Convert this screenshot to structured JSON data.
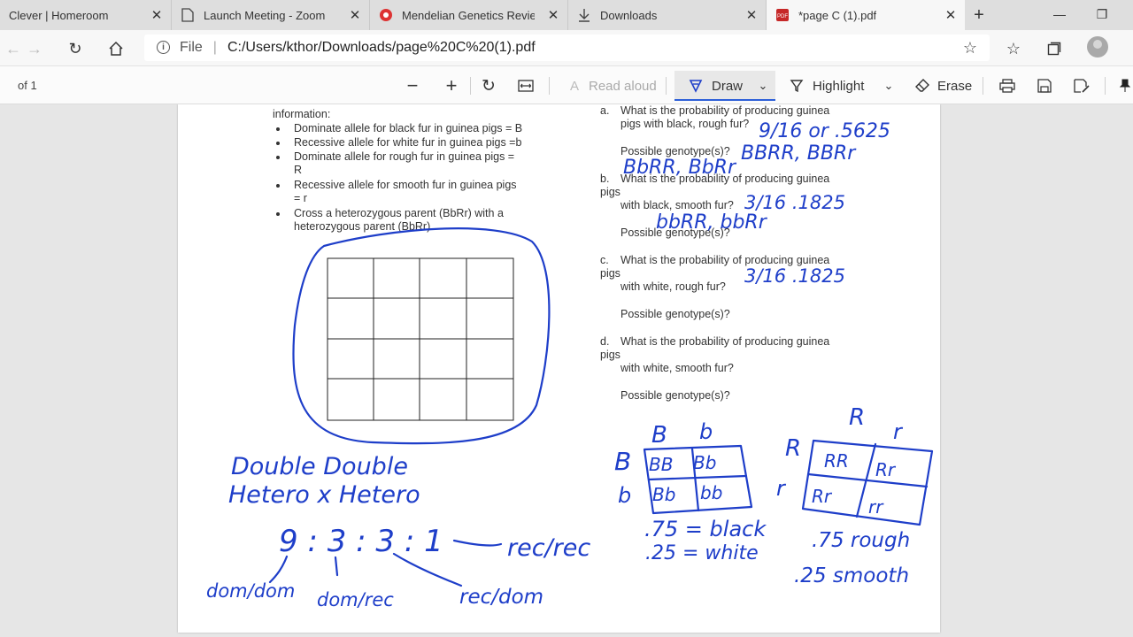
{
  "tabs": [
    {
      "title": "Clever | Homeroom",
      "icon": "none-icon"
    },
    {
      "title": "Launch Meeting - Zoom",
      "icon": "page-icon"
    },
    {
      "title": "Mendelian Genetics Review",
      "icon": "lab-icon"
    },
    {
      "title": "Downloads",
      "icon": "download-icon"
    },
    {
      "title": "*page C (1).pdf",
      "icon": "pdf-icon"
    }
  ],
  "address": {
    "scheme_label": "File",
    "url": "C:/Users/kthor/Downloads/page%20C%20(1).pdf"
  },
  "pdf_toolbar": {
    "page_count": "of 1",
    "read_aloud": "Read aloud",
    "draw": "Draw",
    "highlight": "Highlight",
    "erase": "Erase"
  },
  "document": {
    "intro": "information:",
    "bullets": [
      "Dominate allele for black fur in guinea pigs = B",
      "Recessive allele for white fur in guinea pigs =b",
      "Dominate allele for rough fur in guinea pigs =",
      "R",
      "Recessive allele for smooth fur in guinea pigs",
      "= r",
      "Cross a heterozygous parent (BbRr) with a",
      "heterozygous parent (BbRr)"
    ],
    "questions": [
      {
        "letter": "a.",
        "line1": "What is the probability of producing guinea",
        "line2": "pigs with black, rough fur?",
        "line3": "",
        "genotype": "Possible genotype(s)?"
      },
      {
        "letter": "b.",
        "line1": "What is the probability of producing guinea",
        "line2": "pigs",
        "line3": "with black, smooth fur?",
        "genotype": "Possible genotype(s)?"
      },
      {
        "letter": "c.",
        "line1": "What is the probability of producing guinea",
        "line2": "pigs",
        "line3": "with white, rough fur?",
        "genotype": "Possible genotype(s)?"
      },
      {
        "letter": "d.",
        "line1": "What is the probability of producing guinea",
        "line2": "pigs",
        "line3": "with white, smooth fur?",
        "genotype": "Possible genotype(s)?"
      }
    ]
  },
  "ink": {
    "a_prob": "9/16  or  .5625",
    "a_geno1": "BBRR, BBRr",
    "a_geno2": "BbRR, BbRr",
    "b_prob": "3/16   .1825",
    "b_geno": "bbRR, bbRr",
    "c_prob": "3/16   .1825",
    "double1": "Double   Double",
    "double2": "Hetero  x  Hetero",
    "ratio": "9 : 3 : 3 : 1",
    "recrec": "rec/rec",
    "domdom": "dom/dom",
    "domrec": "dom/rec",
    "recdom": "rec/dom",
    "p1_top_B": "B",
    "p1_top_b": "b",
    "p1_side_B": "B",
    "p1_side_b": "b",
    "p1_cells": [
      "BB",
      "Bb",
      "Bb",
      "bb"
    ],
    "p1_black": ".75 = black",
    "p1_white": ".25 = white",
    "p2_top_R": "R",
    "p2_top_r": "r",
    "p2_side_R": "R",
    "p2_side_r": "r",
    "p2_cells": [
      "RR",
      "Rr",
      "Rr",
      "rr"
    ],
    "p2_rough": ".75 rough",
    "p2_smooth": ".25 smooth"
  },
  "colors": {
    "ink": "#1e3ec9",
    "draw_underline": "#2c5fd8"
  }
}
